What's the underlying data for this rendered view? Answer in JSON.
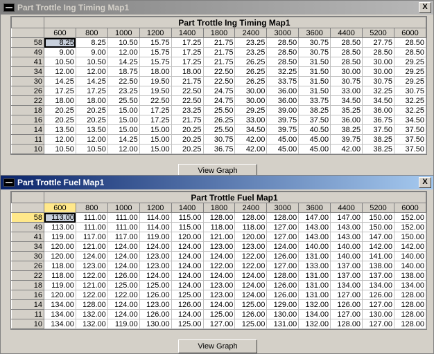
{
  "window1": {
    "title": "Part Trottle Ing Timing Map1",
    "close": "X",
    "table_caption": "Part Trottle Ing Timing Map1",
    "columns": [
      "600",
      "800",
      "1000",
      "1200",
      "1400",
      "1800",
      "2400",
      "3000",
      "3600",
      "4400",
      "5200",
      "6000"
    ],
    "row_headers": [
      "58",
      "49",
      "41",
      "34",
      "30",
      "26",
      "22",
      "18",
      "16",
      "14",
      "11",
      "10"
    ],
    "rows": [
      [
        "8.25",
        "8.25",
        "10.50",
        "15.75",
        "17.25",
        "21.75",
        "23.25",
        "28.50",
        "30.75",
        "28.50",
        "27.75",
        "28.50"
      ],
      [
        "9.00",
        "9.00",
        "12.00",
        "15.75",
        "17.25",
        "21.75",
        "23.25",
        "28.50",
        "30.75",
        "28.50",
        "28.50",
        "28.50"
      ],
      [
        "10.50",
        "10.50",
        "14.25",
        "15.75",
        "17.25",
        "21.75",
        "26.25",
        "28.50",
        "31.50",
        "28.50",
        "30.00",
        "29.25"
      ],
      [
        "12.00",
        "12.00",
        "18.75",
        "18.00",
        "18.00",
        "22.50",
        "26.25",
        "32.25",
        "31.50",
        "30.00",
        "30.00",
        "29.25"
      ],
      [
        "14.25",
        "14.25",
        "22.50",
        "19.50",
        "21.75",
        "22.50",
        "26.25",
        "33.75",
        "31.50",
        "30.75",
        "30.75",
        "29.25"
      ],
      [
        "17.25",
        "17.25",
        "23.25",
        "19.50",
        "22.50",
        "24.75",
        "30.00",
        "36.00",
        "31.50",
        "33.00",
        "32.25",
        "30.75"
      ],
      [
        "18.00",
        "18.00",
        "25.50",
        "22.50",
        "22.50",
        "24.75",
        "30.00",
        "36.00",
        "33.75",
        "34.50",
        "34.50",
        "32.25"
      ],
      [
        "20.25",
        "20.25",
        "15.00",
        "17.25",
        "23.25",
        "25.50",
        "29.25",
        "39.00",
        "38.25",
        "35.25",
        "36.00",
        "32.25"
      ],
      [
        "20.25",
        "20.25",
        "15.00",
        "17.25",
        "21.75",
        "26.25",
        "33.00",
        "39.75",
        "37.50",
        "36.00",
        "36.75",
        "34.50"
      ],
      [
        "13.50",
        "13.50",
        "15.00",
        "15.00",
        "20.25",
        "25.50",
        "34.50",
        "39.75",
        "40.50",
        "38.25",
        "37.50",
        "37.50"
      ],
      [
        "12.00",
        "12.00",
        "14.25",
        "15.00",
        "20.25",
        "30.75",
        "42.00",
        "45.00",
        "45.00",
        "39.75",
        "38.25",
        "37.50"
      ],
      [
        "10.50",
        "10.50",
        "12.00",
        "15.00",
        "20.25",
        "36.75",
        "42.00",
        "45.00",
        "45.00",
        "42.00",
        "38.25",
        "37.50"
      ]
    ],
    "button": "View Graph"
  },
  "window2": {
    "title": "Part Trottle Fuel Map1",
    "close": "X",
    "table_caption": "Part Trottle Fuel Map1",
    "columns": [
      "600",
      "800",
      "1000",
      "1200",
      "1400",
      "1800",
      "2400",
      "3000",
      "3600",
      "4400",
      "5200",
      "6000"
    ],
    "row_headers": [
      "58",
      "49",
      "41",
      "34",
      "30",
      "26",
      "22",
      "18",
      "16",
      "14",
      "11",
      "10"
    ],
    "rows": [
      [
        "113.00",
        "111.00",
        "111.00",
        "114.00",
        "115.00",
        "128.00",
        "128.00",
        "128.00",
        "147.00",
        "147.00",
        "150.00",
        "152.00"
      ],
      [
        "113.00",
        "111.00",
        "111.00",
        "114.00",
        "115.00",
        "118.00",
        "118.00",
        "127.00",
        "143.00",
        "143.00",
        "150.00",
        "152.00"
      ],
      [
        "119.00",
        "117.00",
        "117.00",
        "119.00",
        "120.00",
        "121.00",
        "120.00",
        "127.00",
        "143.00",
        "143.00",
        "147.00",
        "150.00"
      ],
      [
        "120.00",
        "121.00",
        "124.00",
        "124.00",
        "124.00",
        "123.00",
        "123.00",
        "124.00",
        "140.00",
        "140.00",
        "142.00",
        "142.00"
      ],
      [
        "120.00",
        "124.00",
        "124.00",
        "123.00",
        "124.00",
        "124.00",
        "122.00",
        "126.00",
        "131.00",
        "140.00",
        "141.00",
        "140.00"
      ],
      [
        "118.00",
        "123.00",
        "124.00",
        "123.00",
        "124.00",
        "122.00",
        "122.00",
        "127.00",
        "133.00",
        "137.00",
        "138.00",
        "140.00"
      ],
      [
        "118.00",
        "122.00",
        "126.00",
        "124.00",
        "124.00",
        "124.00",
        "124.00",
        "128.00",
        "131.00",
        "137.00",
        "137.00",
        "138.00"
      ],
      [
        "119.00",
        "121.00",
        "125.00",
        "125.00",
        "124.00",
        "123.00",
        "124.00",
        "126.00",
        "131.00",
        "134.00",
        "134.00",
        "134.00"
      ],
      [
        "120.00",
        "122.00",
        "122.00",
        "126.00",
        "125.00",
        "123.00",
        "124.00",
        "126.00",
        "131.00",
        "127.00",
        "126.00",
        "128.00"
      ],
      [
        "134.00",
        "128.00",
        "124.00",
        "123.00",
        "126.00",
        "124.00",
        "125.00",
        "129.00",
        "132.00",
        "126.00",
        "127.00",
        "128.00"
      ],
      [
        "134.00",
        "132.00",
        "124.00",
        "126.00",
        "124.00",
        "125.00",
        "126.00",
        "130.00",
        "134.00",
        "127.00",
        "130.00",
        "128.00"
      ],
      [
        "134.00",
        "132.00",
        "119.00",
        "130.00",
        "125.00",
        "127.00",
        "125.00",
        "131.00",
        "132.00",
        "128.00",
        "127.00",
        "128.00"
      ]
    ],
    "button": "View Graph",
    "highlight_color": "#ffe88a"
  }
}
